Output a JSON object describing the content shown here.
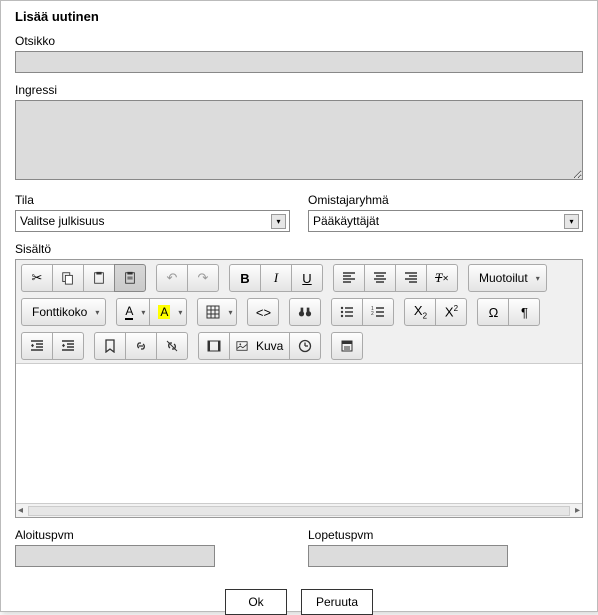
{
  "title": "Lisää uutinen",
  "labels": {
    "otsikko": "Otsikko",
    "ingressi": "Ingressi",
    "tila": "Tila",
    "omistajaryhma": "Omistajaryhmä",
    "sisalto": "Sisältö",
    "aloituspvm": "Aloituspvm",
    "lopetuspvm": "Lopetuspvm"
  },
  "fields": {
    "otsikko_value": "",
    "ingressi_value": "",
    "tila_selected": "Valitse julkisuus",
    "omistajaryhma_selected": "Pääkäyttäjät",
    "aloituspvm_value": "",
    "lopetuspvm_value": ""
  },
  "toolbar": {
    "format_label": "Muotoilut",
    "fontsize_label": "Fonttikoko",
    "image_label": "Kuva"
  },
  "buttons": {
    "ok": "Ok",
    "cancel": "Peruuta"
  }
}
